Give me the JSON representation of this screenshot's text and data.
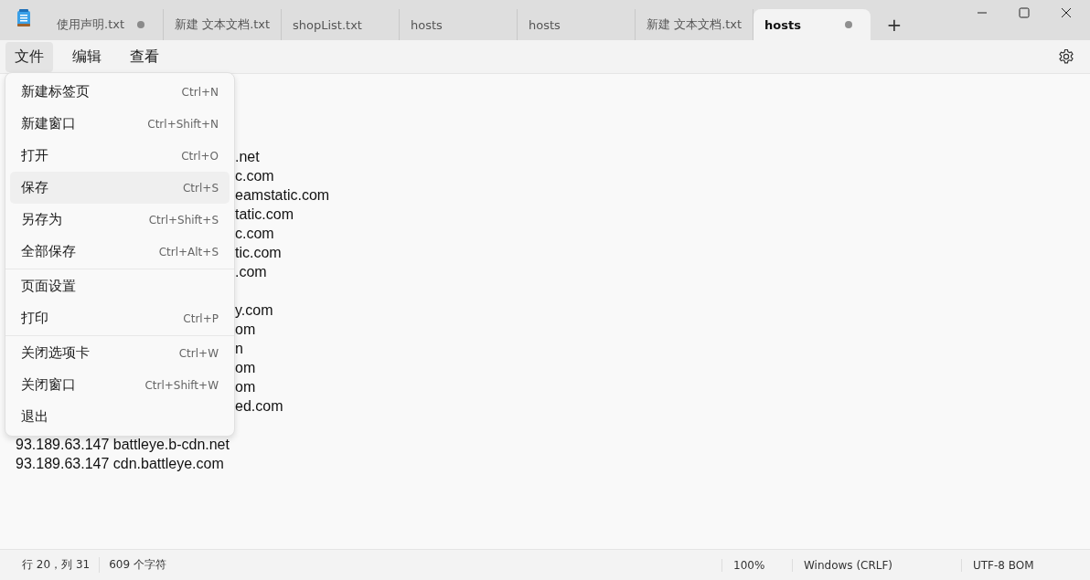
{
  "tabs": [
    {
      "label": "使用声明.txt",
      "selected": false,
      "modified": true
    },
    {
      "label": "新建 文本文档.txt",
      "selected": false,
      "modified": false
    },
    {
      "label": "shopList.txt",
      "selected": false,
      "modified": false
    },
    {
      "label": "hosts",
      "selected": false,
      "modified": false
    },
    {
      "label": "hosts",
      "selected": false,
      "modified": false
    },
    {
      "label": "新建 文本文档.txt",
      "selected": false,
      "modified": false
    },
    {
      "label": "hosts",
      "selected": true,
      "modified": true
    }
  ],
  "new_tab_button": "+",
  "menu_bar": [
    {
      "label": "文件",
      "selected": true
    },
    {
      "label": "编辑",
      "selected": false
    },
    {
      "label": "查看",
      "selected": false
    }
  ],
  "file_menu": [
    {
      "label": "新建标签页",
      "shortcut": "Ctrl+N",
      "highlighted": false,
      "separator_after": false
    },
    {
      "label": "新建窗口",
      "shortcut": "Ctrl+Shift+N",
      "highlighted": false,
      "separator_after": false
    },
    {
      "label": "打开",
      "shortcut": "Ctrl+O",
      "highlighted": false,
      "separator_after": false
    },
    {
      "label": "保存",
      "shortcut": "Ctrl+S",
      "highlighted": true,
      "separator_after": false
    },
    {
      "label": "另存为",
      "shortcut": "Ctrl+Shift+S",
      "highlighted": false,
      "separator_after": false
    },
    {
      "label": "全部保存",
      "shortcut": "Ctrl+Alt+S",
      "highlighted": false,
      "separator_after": true
    },
    {
      "label": "页面设置",
      "highlighted": false,
      "separator_after": false
    },
    {
      "label": "打印",
      "shortcut": "Ctrl+P",
      "highlighted": false,
      "separator_after": true
    },
    {
      "label": "关闭选项卡",
      "shortcut": "Ctrl+W",
      "highlighted": false,
      "separator_after": false
    },
    {
      "label": "关闭窗口",
      "shortcut": "Ctrl+Shift+W",
      "highlighted": false,
      "separator_after": false
    },
    {
      "label": "退出",
      "highlighted": false,
      "separator_after": false
    }
  ],
  "editor_lines": [
    {
      "kind": "partial",
      "text": ".net"
    },
    {
      "kind": "partial",
      "text": "c.com"
    },
    {
      "kind": "partial",
      "text": "eamstatic.com"
    },
    {
      "kind": "partial",
      "text": "tatic.com"
    },
    {
      "kind": "partial",
      "text": "c.com"
    },
    {
      "kind": "partial",
      "text": "tic.com"
    },
    {
      "kind": "partial",
      "text": ".com"
    },
    {
      "kind": "blank"
    },
    {
      "kind": "partial",
      "text": "y.com"
    },
    {
      "kind": "partial",
      "text": "om"
    },
    {
      "kind": "partial",
      "text": "n"
    },
    {
      "kind": "partial",
      "text": "om"
    },
    {
      "kind": "partial",
      "text": "om"
    },
    {
      "kind": "partial",
      "text": "ed.com"
    },
    {
      "kind": "blank"
    },
    {
      "kind": "full",
      "text": "93.189.63.147 battleye.b-cdn.net"
    },
    {
      "kind": "full",
      "text": "93.189.63.147 cdn.battleye.com"
    }
  ],
  "status_bar": {
    "position": "行 20，列 31",
    "characters": "609 个字符",
    "zoom": "100%",
    "line_ending": "Windows (CRLF)",
    "encoding": "UTF-8 BOM"
  }
}
